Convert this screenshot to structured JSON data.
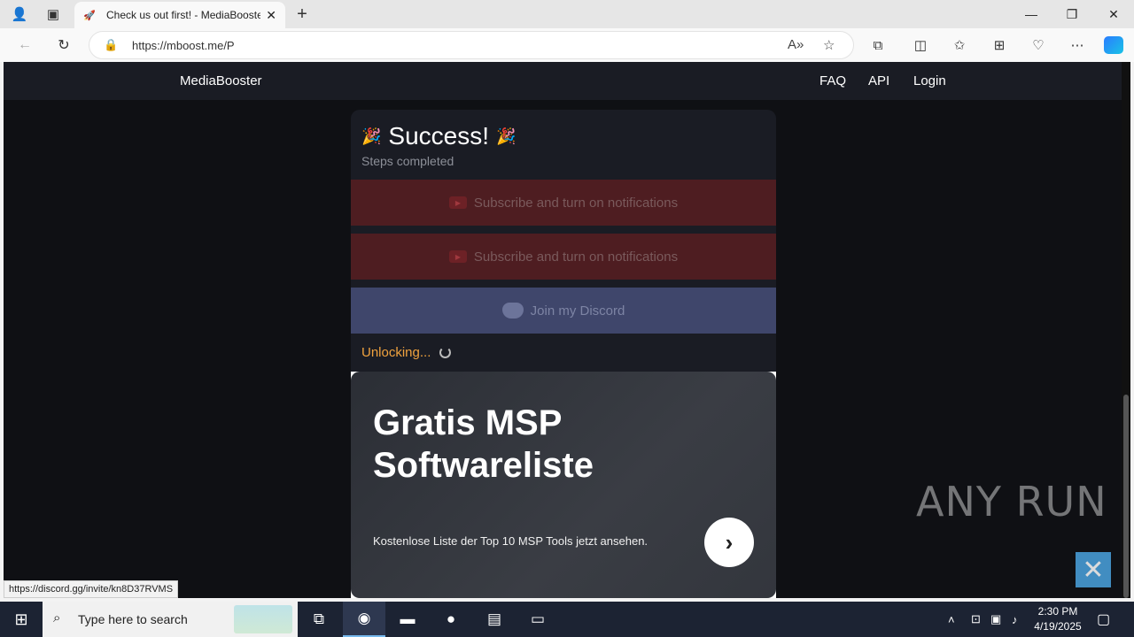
{
  "browser": {
    "tab_title": "Check us out first! - MediaBooster",
    "url": "https://mboost.me/P",
    "status_url": "https://discord.gg/invite/kn8D37RVMS"
  },
  "site": {
    "brand": "MediaBooster",
    "nav": [
      "FAQ",
      "API",
      "Login"
    ]
  },
  "card": {
    "title": "Success!",
    "subtitle": "Steps completed",
    "steps": [
      {
        "label": "Subscribe and turn on notifications",
        "icon": "youtube-icon"
      },
      {
        "label": "Subscribe and turn on notifications",
        "icon": "youtube-icon"
      },
      {
        "label": "Join my Discord",
        "icon": "discord-icon"
      }
    ],
    "status": "Unlocking..."
  },
  "ad": {
    "headline": "Gratis MSP Softwareliste",
    "body": "Kostenlose Liste der Top 10 MSP Tools jetzt ansehen."
  },
  "watermark": "ANY RUN",
  "taskbar": {
    "search_placeholder": "Type here to search",
    "time": "2:30 PM",
    "date": "4/19/2025"
  },
  "colors": {
    "page_bg": "#0f1014",
    "card_bg": "#1a1c24",
    "youtube_step": "#4e1d21",
    "discord_step": "#3f466b",
    "unlocking": "#f0a23e"
  }
}
